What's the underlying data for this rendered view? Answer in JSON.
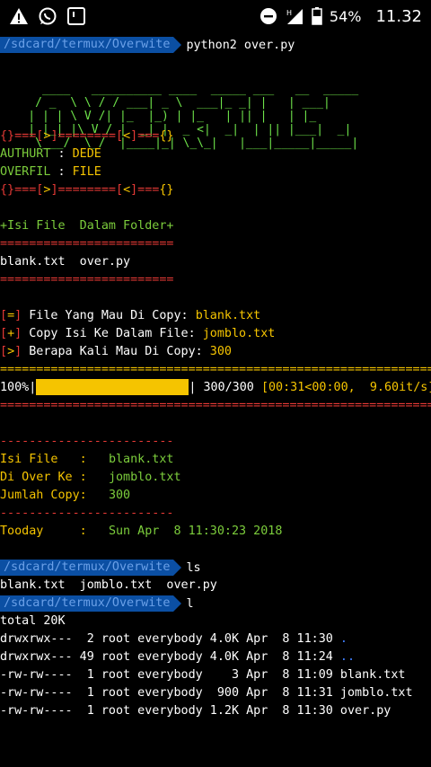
{
  "status_bar": {
    "battery": "54%",
    "time": "11.32"
  },
  "prompt_path": "/sdcard/termux/Overwite",
  "cmd1": "python2 over.py",
  "banner": [
    "      ____   __________ ____  _____ ___   __  _____",
    "     / _  \\ \\ / / ___| _ \\  ___|_ _| |   | ___|",
    "    | | | \\ V /| |_  |_) | |_   | || |   | |_",
    "    | |_| |\\ V / |  _| |  _ <|  _|  | || |___|  _|",
    "     \\___/  \\_/  |____|_| \\_\\_|   |___|_____|_____|"
  ],
  "sep_top": {
    "a": "{}===[",
    "b": ">",
    "c": "]========[",
    "d": "<",
    "e": "]===",
    "f": "{}"
  },
  "author_label": "AUTHURT",
  "author_value": "DEDE",
  "overfil_label": "OVERFIL",
  "overfil_value": "FILE",
  "isi_header": "+Isi File  Dalam Folder+",
  "eq_short": "========================",
  "files_listing": "blank.txt  over.py",
  "q1_tag": "=",
  "q1_text": "File Yang Mau Di Copy: ",
  "q1_val": "blank.txt",
  "q2_tag": "+",
  "q2_text": "Copy Isi Ke Dalam File: ",
  "q2_val": "jomblo.txt",
  "q3_tag": ">",
  "q3_text": "Berapa Kali Mau Di Copy: ",
  "q3_val": "300",
  "eq_long": "=================================================================",
  "progress": {
    "pct_label": "100%",
    "fraction": 1.0,
    "count": "300/300",
    "timing": "[00:31<00:00,  9.60it/s]"
  },
  "dash": "------------------------",
  "sum_isi_label": "Isi File   :",
  "sum_isi_val": "blank.txt",
  "sum_over_label": "Di Over Ke :",
  "sum_over_val": "jomblo.txt",
  "sum_jml_label": "Jumlah Copy:",
  "sum_jml_val": "300",
  "today_label": "Tooday     :",
  "today_val": "Sun Apr  8 11:30:23 2018",
  "cmd2": "ls",
  "ls_out": "blank.txt  jomblo.txt  over.py",
  "cmd3": "l",
  "total": "total 20K",
  "rows": [
    {
      "text": "drwxrwx---  2 root everybody 4.0K Apr  8 11:30 ",
      "name": ".",
      "dir": true
    },
    {
      "text": "drwxrwx--- 49 root everybody 4.0K Apr  8 11:24 ",
      "name": "..",
      "dir": true
    },
    {
      "text": "-rw-rw----  1 root everybody    3 Apr  8 11:09 ",
      "name": "blank.txt",
      "dir": false
    },
    {
      "text": "-rw-rw----  1 root everybody  900 Apr  8 11:31 ",
      "name": "jomblo.txt",
      "dir": false
    },
    {
      "text": "-rw-rw----  1 root everybody 1.2K Apr  8 11:30 ",
      "name": "over.py",
      "dir": false
    }
  ]
}
